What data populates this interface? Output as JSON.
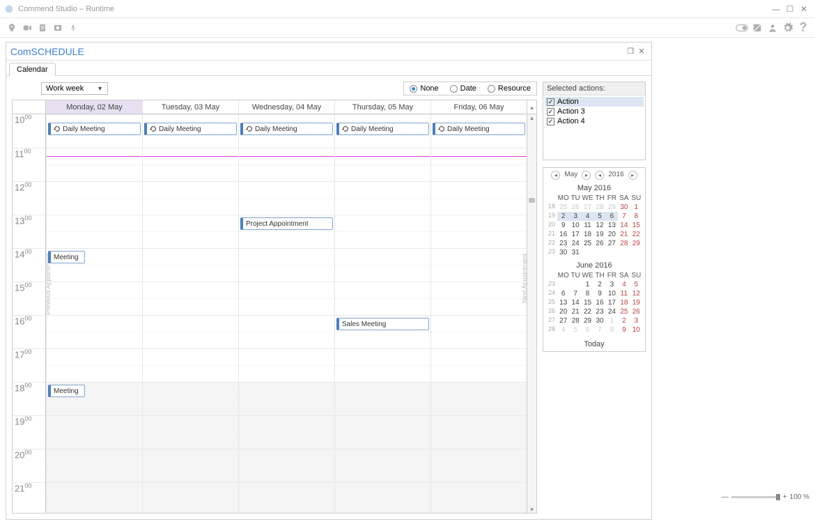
{
  "window": {
    "title": "Commend Studio – Runtime"
  },
  "panel": {
    "title": "ComSCHEDULE"
  },
  "tabs": {
    "calendar": "Calendar"
  },
  "view_select": "Work week",
  "group_by": {
    "none": "None",
    "date": "Date",
    "resource": "Resource"
  },
  "days": [
    "Monday, 02 May",
    "Tuesday, 03 May",
    "Wednesday, 04 May",
    "Thursday, 05 May",
    "Friday, 06 May"
  ],
  "hours": [
    "10",
    "11",
    "12",
    "13",
    "14",
    "15",
    "16",
    "17",
    "18",
    "19",
    "20",
    "21"
  ],
  "events": {
    "daily": "Daily Meeting",
    "project": "Project Appointment",
    "sales": "Sales Meeting",
    "meeting": "Meeting"
  },
  "side_labels": {
    "prev": "Previous Appointment",
    "next": "Next Appointment"
  },
  "actions": {
    "title": "Selected actions:",
    "items": [
      "Action",
      "Action 3",
      "Action 4"
    ]
  },
  "nav": {
    "month": "May",
    "year": "2016"
  },
  "minical": {
    "may": {
      "title": "May 2016",
      "headers": [
        "MO",
        "TU",
        "WE",
        "TH",
        "FR",
        "SA",
        "SU"
      ],
      "weeks": [
        {
          "wk": "18",
          "days": [
            {
              "n": "25",
              "g": 1
            },
            {
              "n": "26",
              "g": 1
            },
            {
              "n": "27",
              "g": 1
            },
            {
              "n": "28",
              "g": 1
            },
            {
              "n": "29",
              "g": 1
            },
            {
              "n": "30",
              "r": 1,
              "g": 1
            },
            {
              "n": "1",
              "r": 1
            }
          ]
        },
        {
          "wk": "19",
          "days": [
            {
              "n": "2",
              "s": 1
            },
            {
              "n": "3",
              "s": 1
            },
            {
              "n": "4",
              "s": 1
            },
            {
              "n": "5",
              "s": 1
            },
            {
              "n": "6",
              "s": 1
            },
            {
              "n": "7",
              "r": 1
            },
            {
              "n": "8",
              "r": 1
            }
          ]
        },
        {
          "wk": "20",
          "days": [
            {
              "n": "9"
            },
            {
              "n": "10"
            },
            {
              "n": "11"
            },
            {
              "n": "12"
            },
            {
              "n": "13"
            },
            {
              "n": "14",
              "r": 1
            },
            {
              "n": "15",
              "r": 1
            }
          ]
        },
        {
          "wk": "21",
          "days": [
            {
              "n": "16"
            },
            {
              "n": "17"
            },
            {
              "n": "18"
            },
            {
              "n": "19"
            },
            {
              "n": "20"
            },
            {
              "n": "21",
              "r": 1
            },
            {
              "n": "22",
              "r": 1
            }
          ]
        },
        {
          "wk": "22",
          "days": [
            {
              "n": "23"
            },
            {
              "n": "24"
            },
            {
              "n": "25"
            },
            {
              "n": "26"
            },
            {
              "n": "27"
            },
            {
              "n": "28",
              "r": 1
            },
            {
              "n": "29",
              "r": 1
            }
          ]
        },
        {
          "wk": "23",
          "days": [
            {
              "n": "30"
            },
            {
              "n": "31"
            },
            {
              "n": "",
              "g": 1
            },
            {
              "n": "",
              "g": 1
            },
            {
              "n": "",
              "g": 1
            },
            {
              "n": "",
              "g": 1
            },
            {
              "n": "",
              "g": 1
            }
          ]
        }
      ]
    },
    "june": {
      "title": "June 2016",
      "headers": [
        "MO",
        "TU",
        "WE",
        "TH",
        "FR",
        "SA",
        "SU"
      ],
      "weeks": [
        {
          "wk": "23",
          "days": [
            {
              "n": "",
              "g": 1
            },
            {
              "n": "",
              "g": 1
            },
            {
              "n": "1"
            },
            {
              "n": "2"
            },
            {
              "n": "3"
            },
            {
              "n": "4",
              "r": 1
            },
            {
              "n": "5",
              "r": 1
            }
          ]
        },
        {
          "wk": "24",
          "days": [
            {
              "n": "6"
            },
            {
              "n": "7"
            },
            {
              "n": "8"
            },
            {
              "n": "9"
            },
            {
              "n": "10"
            },
            {
              "n": "11",
              "r": 1
            },
            {
              "n": "12",
              "r": 1
            }
          ]
        },
        {
          "wk": "25",
          "days": [
            {
              "n": "13"
            },
            {
              "n": "14"
            },
            {
              "n": "15"
            },
            {
              "n": "16"
            },
            {
              "n": "17"
            },
            {
              "n": "18",
              "r": 1
            },
            {
              "n": "19",
              "r": 1
            }
          ]
        },
        {
          "wk": "26",
          "days": [
            {
              "n": "20"
            },
            {
              "n": "21"
            },
            {
              "n": "22"
            },
            {
              "n": "23"
            },
            {
              "n": "24"
            },
            {
              "n": "25",
              "r": 1
            },
            {
              "n": "26",
              "r": 1
            }
          ]
        },
        {
          "wk": "27",
          "days": [
            {
              "n": "27"
            },
            {
              "n": "28"
            },
            {
              "n": "29"
            },
            {
              "n": "30"
            },
            {
              "n": "1",
              "g": 1
            },
            {
              "n": "2",
              "g": 1,
              "r": 1
            },
            {
              "n": "3",
              "g": 1,
              "r": 1
            }
          ]
        },
        {
          "wk": "28",
          "days": [
            {
              "n": "4",
              "g": 1
            },
            {
              "n": "5",
              "g": 1
            },
            {
              "n": "6",
              "g": 1
            },
            {
              "n": "7",
              "g": 1
            },
            {
              "n": "8",
              "g": 1
            },
            {
              "n": "9",
              "g": 1,
              "r": 1
            },
            {
              "n": "10",
              "g": 1,
              "r": 1
            }
          ]
        }
      ]
    },
    "today": "Today"
  },
  "zoom": {
    "percent": "100 %"
  }
}
